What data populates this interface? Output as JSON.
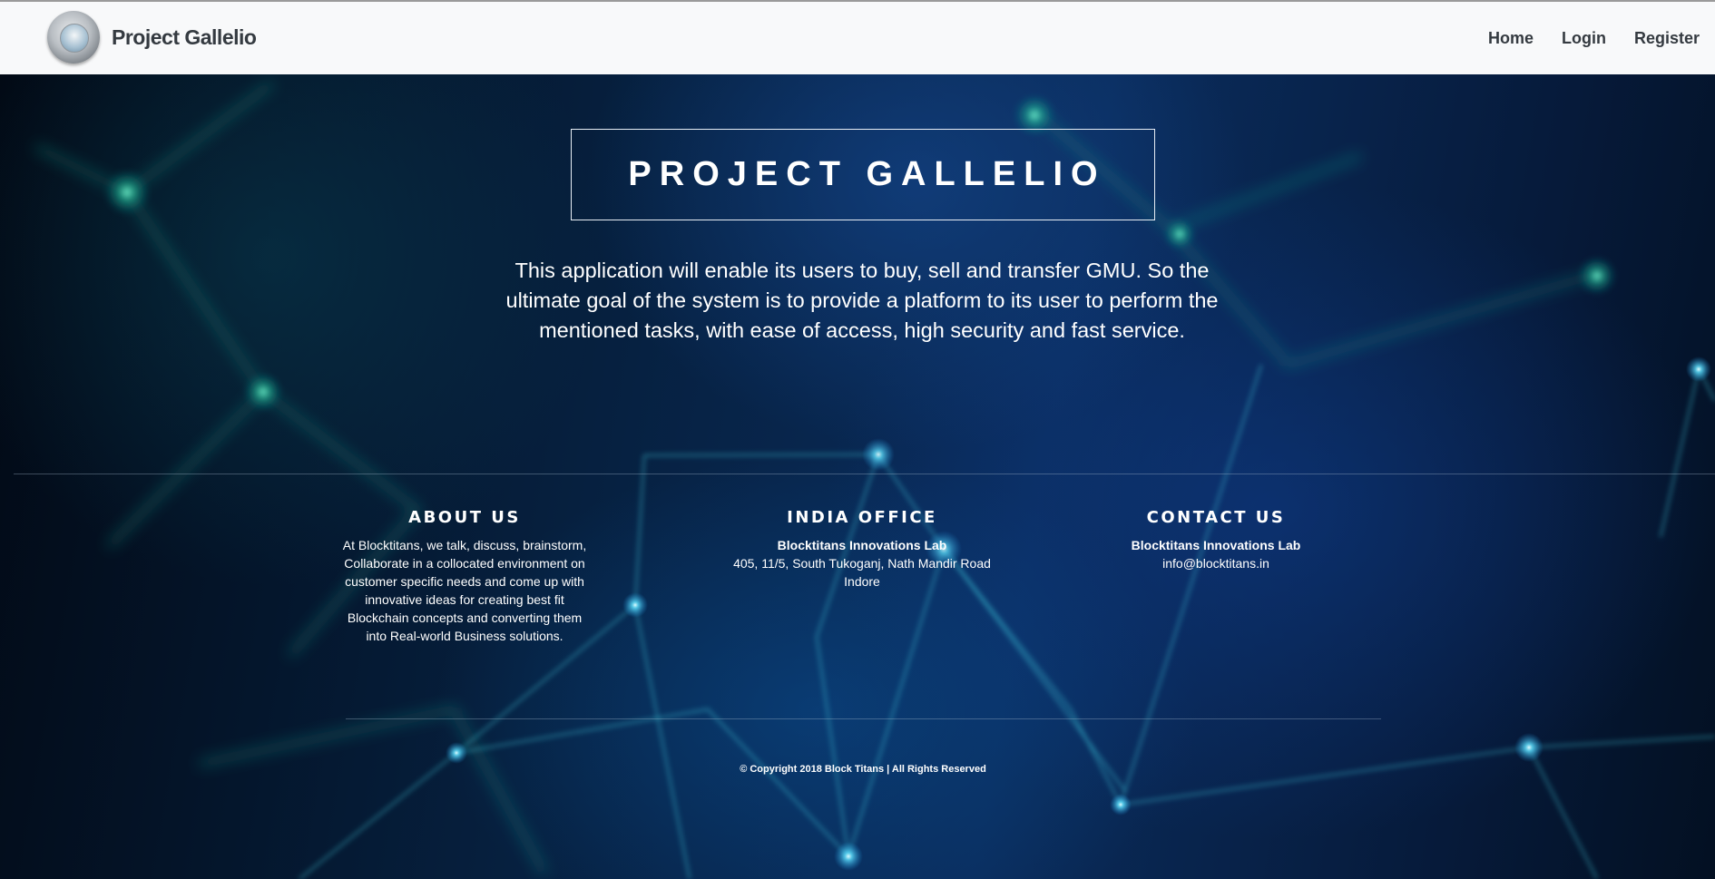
{
  "navbar": {
    "brand": "Project Gallelio",
    "links": [
      "Home",
      "Login",
      "Register"
    ]
  },
  "hero": {
    "title": "PROJECT GALLELIO",
    "tagline": "This application will enable its users to buy, sell and transfer GMU. So the ultimate goal of the system is to provide a platform to its user to perform the mentioned tasks, with ease of access, high security and fast service."
  },
  "footer": {
    "about": {
      "heading": "ABOUT US",
      "text": "At Blocktitans, we talk, discuss, brainstorm, Collaborate in a collocated environment on customer specific needs and come up with innovative ideas for creating best fit Blockchain concepts and converting them into Real-world Business solutions."
    },
    "office": {
      "heading": "INDIA OFFICE",
      "company": "Blocktitans Innovations Lab",
      "address": "405, 11/5, South Tukoganj, Nath Mandir Road Indore"
    },
    "contact": {
      "heading": "CONTACT US",
      "company": "Blocktitans Innovations Lab",
      "email": "info@blocktitans.in"
    },
    "copyright": "© Copyright 2018 Block Titans | All Rights Reserved"
  }
}
